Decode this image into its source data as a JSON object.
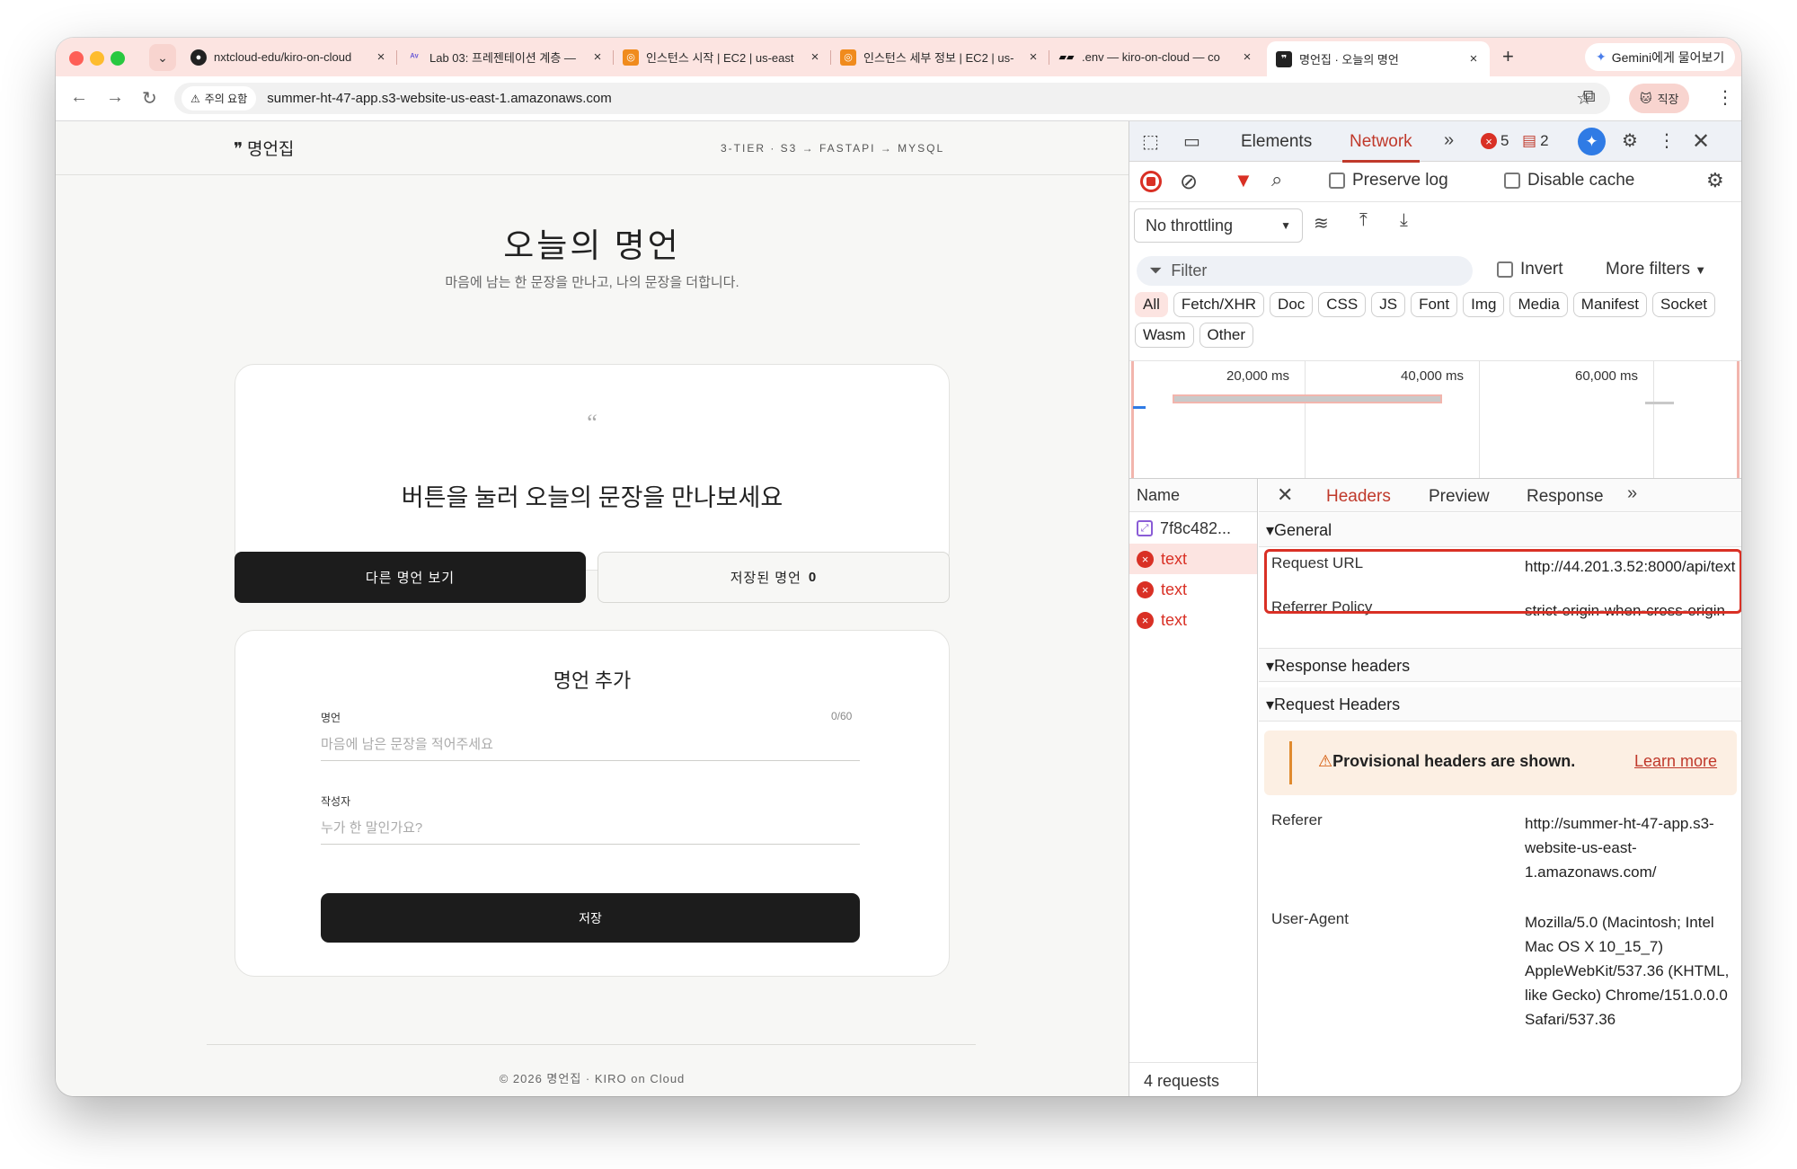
{
  "browser": {
    "tabs": [
      {
        "title": "nxtcloud-edu/kiro-on-cloud",
        "favicon": "github-icon"
      },
      {
        "title": "Lab 03: 프레젠테이션 계층 — ",
        "favicon": "lab-icon"
      },
      {
        "title": "인스턴스 시작 | EC2 | us-east",
        "favicon": "aws-icon"
      },
      {
        "title": "인스턴스 세부 정보 | EC2 | us-",
        "favicon": "aws-icon"
      },
      {
        "title": ".env — kiro-on-cloud — co",
        "favicon": "codespace-icon"
      },
      {
        "title": "명언집 · 오늘의 명언",
        "favicon": "site-icon"
      }
    ],
    "gemini_label": "Gemini에게 물어보기",
    "security_label": "주의 요함",
    "url": "summer-ht-47-app.s3-website-us-east-1.amazonaws.com",
    "profile_label": "직장"
  },
  "page": {
    "logo": "❞ 명언집",
    "stack": "3-TIER · S3 → FASTAPI → MYSQL",
    "title": "오늘의 명언",
    "subtitle": "마음에 남는 한 문장을 만나고, 나의 문장을 더합니다.",
    "quote_mark": "“",
    "quote_text": "버튼을 눌러 오늘의 문장을 만나보세요",
    "btn_other": "다른 명언 보기",
    "btn_saved": "저장된 명언",
    "saved_count": "0",
    "form": {
      "title": "명언 추가",
      "quote_label": "명언",
      "quote_count": "0/60",
      "quote_placeholder": "마음에 남은 문장을 적어주세요",
      "author_label": "작성자",
      "author_placeholder": "누가 한 말인가요?",
      "save_label": "저장"
    },
    "footer": "© 2026 명언집 · KIRO on Cloud"
  },
  "devtools": {
    "tab_elements": "Elements",
    "tab_network": "Network",
    "error_count": "5",
    "message_count": "2",
    "preserve_log": "Preserve log",
    "disable_cache": "Disable cache",
    "throttling": "No throttling",
    "filter_placeholder": "Filter",
    "invert": "Invert",
    "more_filters": "More filters",
    "type_filters": [
      "All",
      "Fetch/XHR",
      "Doc",
      "CSS",
      "JS",
      "Font",
      "Img",
      "Media",
      "Manifest",
      "Socket",
      "Wasm",
      "Other"
    ],
    "timeline_ticks": [
      "20,000 ms",
      "40,000 ms",
      "60,000 ms"
    ],
    "name_header": "Name",
    "requests": [
      {
        "name": "7f8c482...",
        "status": "ok"
      },
      {
        "name": "text",
        "status": "error"
      },
      {
        "name": "text",
        "status": "error"
      },
      {
        "name": "text",
        "status": "error"
      }
    ],
    "request_count": "4 requests",
    "detail_tabs": [
      "Headers",
      "Preview",
      "Response"
    ],
    "general_label": "General",
    "request_url_key": "Request URL",
    "request_url": "http://44.201.3.52:8000/api/text",
    "referrer_policy_key": "Referrer Policy",
    "referrer_policy": "strict-origin-when-cross-origin",
    "response_headers_label": "Response headers",
    "request_headers_label": "Request Headers",
    "provisional": "Provisional headers are shown.",
    "learn_more": "Learn more",
    "referer_key": "Referer",
    "referer": "http://summer-ht-47-app.s3-website-us-east-1.amazonaws.com/",
    "user_agent_key": "User-Agent",
    "user_agent": "Mozilla/5.0 (Macintosh; Intel Mac OS X 10_15_7) AppleWebKit/537.36 (KHTML, like Gecko) Chrome/151.0.0.0 Safari/537.36"
  },
  "colors": {
    "accent_red": "#d93025",
    "tab_bar": "#fce4e1",
    "dark_button": "#1c1c1c"
  }
}
